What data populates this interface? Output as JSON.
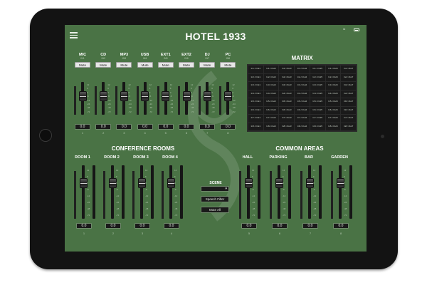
{
  "app": {
    "title": "HOTEL 1933"
  },
  "sections": {
    "matrix": "MATRIX",
    "conference": "CONFERENCE ROOMS",
    "common": "COMMON AREAS"
  },
  "input_channels": [
    {
      "name": "MIC",
      "sub": "IN1",
      "mute": "Mute",
      "value": "0.0",
      "num": "1",
      "level": 0.6
    },
    {
      "name": "CD",
      "sub": "IN2",
      "mute": "Mute",
      "value": "0.0",
      "num": "2",
      "level": 0.6
    },
    {
      "name": "MP3",
      "sub": "IN3",
      "mute": "Mute",
      "value": "0.0",
      "num": "3",
      "level": 0.6
    },
    {
      "name": "USB",
      "sub": "IN4",
      "mute": "Mute",
      "value": "0.0",
      "num": "4",
      "level": 0.6
    },
    {
      "name": "EXT1",
      "sub": "IN5",
      "mute": "Mute",
      "value": "0.0",
      "num": "5",
      "level": 0.6
    },
    {
      "name": "EXT2",
      "sub": "IN6",
      "mute": "Mute",
      "value": "0.0",
      "num": "6",
      "level": 0.6
    },
    {
      "name": "DJ",
      "sub": "IN7",
      "mute": "Mute",
      "value": "0.0",
      "num": "7",
      "level": 0.6
    },
    {
      "name": "PC",
      "sub": "IN8",
      "mute": "Mute",
      "value": "0.0",
      "num": "8",
      "level": 0.6
    }
  ],
  "input_scale": [
    "12",
    "6",
    "0",
    "-6",
    "-12",
    "-24",
    "-48",
    "-72"
  ],
  "matrix": {
    "cells": [
      [
        "In1->Out1",
        "In1->Out2",
        "In1->Out3",
        "In1->Out4",
        "In1->Out5",
        "In1->Out6",
        "In1->Out7"
      ],
      [
        "In2->Out1",
        "In2->Out2",
        "In2->Out3",
        "In2->Out4",
        "In2->Out5",
        "In2->Out6",
        "In2->Out7"
      ],
      [
        "In3->Out1",
        "In3->Out2",
        "In3->Out3",
        "In3->Out4",
        "In3->Out5",
        "In3->Out6",
        "In3->Out7"
      ],
      [
        "In4->Out1",
        "In4->Out2",
        "In4->Out3",
        "In4->Out4",
        "In4->Out5",
        "In4->Out6",
        "In4->Out7"
      ],
      [
        "In5->Out1",
        "In5->Out2",
        "In5->Out3",
        "In5->Out4",
        "In5->Out5",
        "In5->Out6",
        "In5->Out7"
      ],
      [
        "In6->Out1",
        "In6->Out2",
        "In6->Out3",
        "In6->Out4",
        "In6->Out5",
        "In6->Out6",
        "In6->Out7"
      ],
      [
        "In7->Out1",
        "In7->Out2",
        "In7->Out3",
        "In7->Out4",
        "In7->Out5",
        "In7->Out6",
        "In7->Out7"
      ],
      [
        "In8->Out1",
        "In8->Out2",
        "In8->Out3",
        "In8->Out4",
        "In8->Out5",
        "In8->Out6",
        "In8->Out7"
      ]
    ]
  },
  "conference_rooms": [
    {
      "name": "ROOM 1",
      "value": "0.0",
      "num": "1",
      "level": 0.7
    },
    {
      "name": "ROOM 2",
      "value": "0.0",
      "num": "2",
      "level": 0.7
    },
    {
      "name": "ROOM 3",
      "value": "0.0",
      "num": "3",
      "level": 0.7
    },
    {
      "name": "ROOM 4",
      "value": "0.0",
      "num": "4",
      "level": 0.7
    }
  ],
  "common_areas": [
    {
      "name": "HALL",
      "value": "0.0",
      "num": "5",
      "level": 0.7
    },
    {
      "name": "PARKING",
      "value": "0.0",
      "num": "6",
      "level": 0.7
    },
    {
      "name": "BAR",
      "value": "0.0",
      "num": "7",
      "level": 0.7
    },
    {
      "name": "GARDEN",
      "value": "0.0",
      "num": "8",
      "level": 0.7
    }
  ],
  "output_scale": [
    "12",
    "6",
    "0",
    "-6",
    "-12",
    "-24",
    "-48",
    "-72"
  ],
  "scene": {
    "label": "SCENE",
    "select_value": "",
    "speech_filter": "Speech Filter",
    "mute_all": "Mute All"
  },
  "colors": {
    "screen_bg": "#4a7345",
    "device_body": "#131313"
  },
  "icons": {
    "menu": "hamburger-menu-icon",
    "wifi": "wifi-icon",
    "battery": "battery-icon"
  }
}
